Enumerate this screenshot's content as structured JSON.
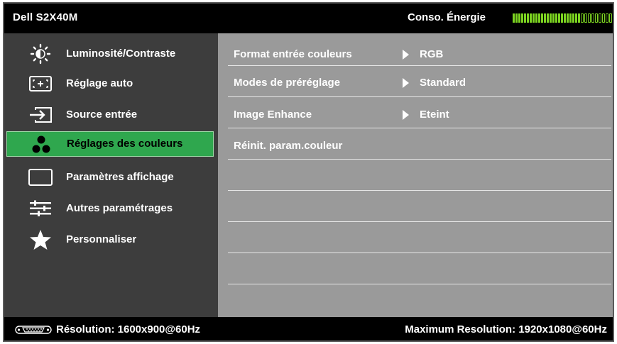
{
  "header": {
    "model": "Dell S2X40M",
    "energy_label": "Conso. Énergie",
    "energy_level": 0.73,
    "accent": "#7cd321"
  },
  "menu": {
    "items": [
      {
        "label": "Luminosité/Contraste",
        "icon": "brightness-icon"
      },
      {
        "label": "Réglage auto",
        "icon": "auto-adjust-icon"
      },
      {
        "label": "Source entrée",
        "icon": "input-source-icon"
      },
      {
        "label": "Réglages des couleurs",
        "icon": "color-dots-icon",
        "selected": true
      },
      {
        "label": "Paramètres affichage",
        "icon": "display-frame-icon"
      },
      {
        "label": "Autres paramétrages",
        "icon": "sliders-icon"
      },
      {
        "label": "Personnaliser",
        "icon": "star-icon"
      }
    ],
    "selected_color": "#2fa74e"
  },
  "submenu": {
    "rows": [
      {
        "label": "Format entrée couleurs",
        "value": "RGB"
      },
      {
        "label": "Modes de préréglage",
        "value": "Standard"
      },
      {
        "label": "Image Enhance",
        "value": "Eteint"
      },
      {
        "label": "Réinit. param.couleur",
        "value": ""
      }
    ]
  },
  "footer": {
    "resolution": "Résolution: 1600x900@60Hz",
    "max_resolution": "Maximum Resolution: 1920x1080@60Hz",
    "connector_icon": "vga-connector-icon"
  }
}
